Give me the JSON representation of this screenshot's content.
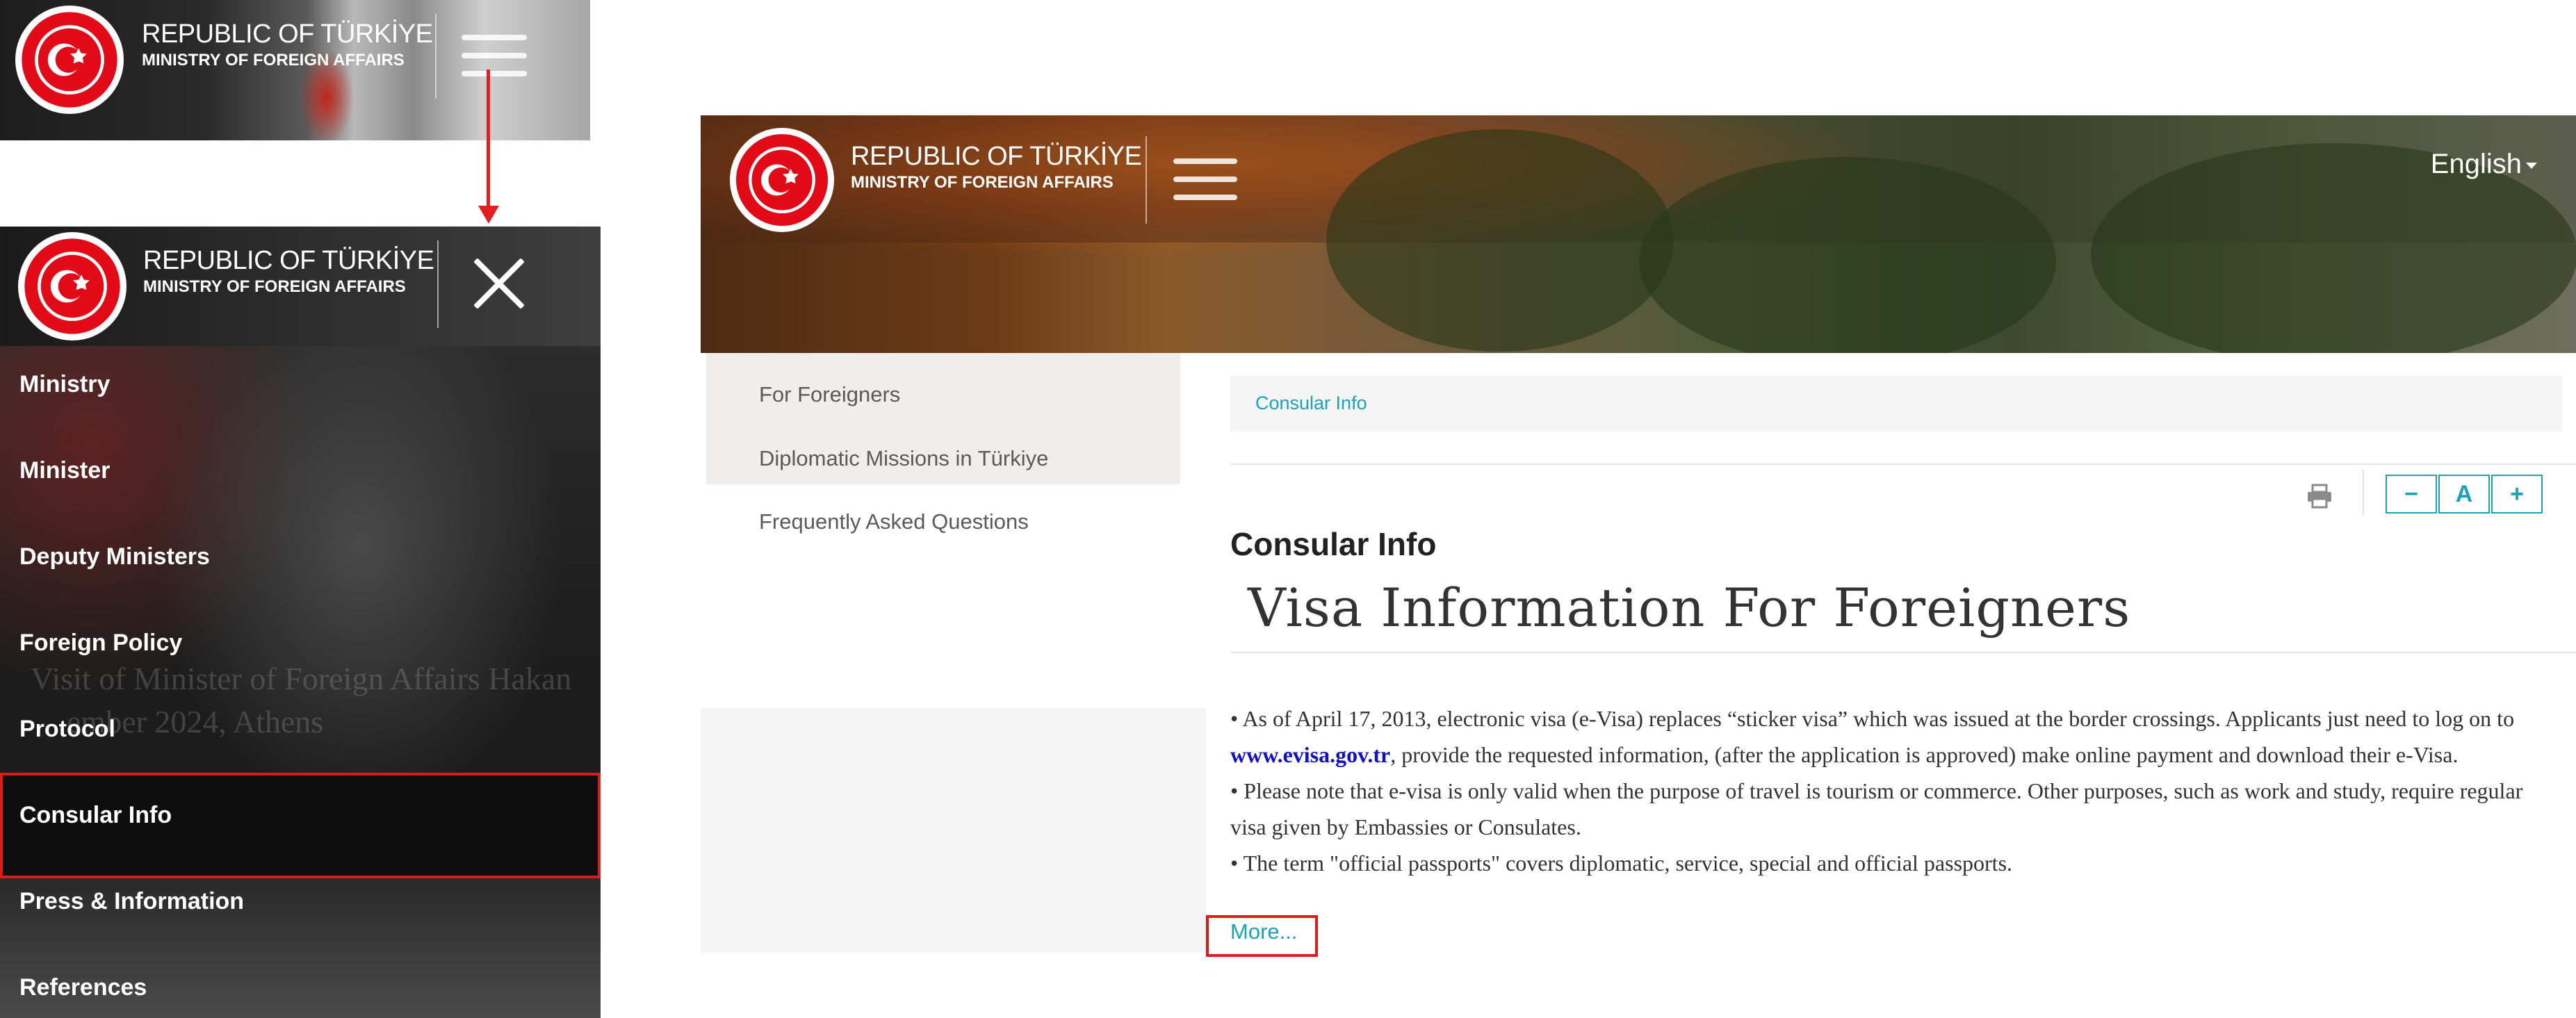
{
  "brand": {
    "line1": "REPUBLIC OF TÜRKİYE",
    "line2": "MINISTRY OF FOREIGN AFFAIRS"
  },
  "menu": {
    "items": [
      {
        "label": "Ministry"
      },
      {
        "label": "Minister"
      },
      {
        "label": "Deputy Ministers"
      },
      {
        "label": "Foreign Policy"
      },
      {
        "label": "Protocol"
      },
      {
        "label": "Consular Info"
      },
      {
        "label": "Press & Information"
      },
      {
        "label": "References"
      }
    ],
    "highlighted": "Consular Info",
    "background_text_line1": "Visit of Minister of Foreign Affairs Hakan",
    "background_text_line2": "ember 2024, Athens"
  },
  "desktop": {
    "language": "English",
    "left_nav": [
      {
        "label": "For Foreigners"
      },
      {
        "label": "Diplomatic Missions in Türkiye"
      },
      {
        "label": "Frequently Asked Questions"
      }
    ],
    "breadcrumb": "Consular Info",
    "font_tools": {
      "decrease": "−",
      "reset": "A",
      "increase": "+"
    },
    "section_title": "Consular Info",
    "page_title": "Visa Information For Foreigners",
    "body": {
      "p1_before": "• As of April 17, 2013, electronic visa (e-Visa) replaces “sticker visa” which was issued at the border crossings.  Applicants just need to log on to ",
      "p1_link": "www.evisa.gov.tr",
      "p1_after": ", provide the requested information, (after the application is approved) make online payment and download their e-Visa.",
      "p2": "• Please note that e-visa is only valid when the purpose of travel is tourism or commerce. Other purposes, such as work and study, require regular visa given by Embassies or Consulates.",
      "p3": "• The term \"official passports\" covers diplomatic, service, special and official passports."
    },
    "more_link": "More..."
  },
  "colors": {
    "accent_teal": "#1aa3b8",
    "highlight_red": "#e0191b",
    "emblem_red": "#e30a17",
    "link_blue": "#1010c8"
  }
}
